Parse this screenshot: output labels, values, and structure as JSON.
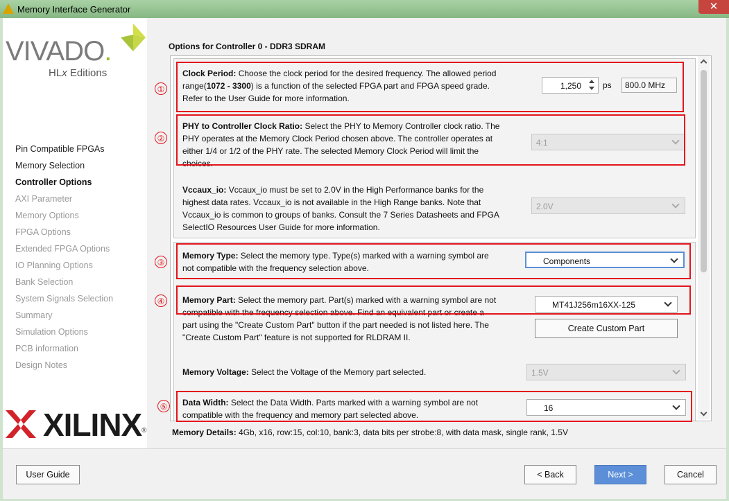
{
  "window": {
    "title": "Memory Interface Generator",
    "close_glyph": "✕"
  },
  "logo": {
    "vivado": "VIVADO",
    "vivado_dot": ".",
    "hlx_prefix": "HL",
    "hlx_x": "x",
    "hlx_suffix": " Editions",
    "xilinx": "XILINX",
    "reg": "®"
  },
  "sidebar": {
    "items": [
      {
        "label": "Pin Compatible FPGAs",
        "state": "done"
      },
      {
        "label": "Memory Selection",
        "state": "done"
      },
      {
        "label": "Controller Options",
        "state": "current"
      },
      {
        "label": "AXI Parameter",
        "state": "pending"
      },
      {
        "label": "Memory Options",
        "state": "pending"
      },
      {
        "label": "FPGA Options",
        "state": "pending"
      },
      {
        "label": "Extended FPGA Options",
        "state": "pending"
      },
      {
        "label": "IO Planning Options",
        "state": "pending"
      },
      {
        "label": "Bank Selection",
        "state": "pending"
      },
      {
        "label": "System Signals Selection",
        "state": "pending"
      },
      {
        "label": "Summary",
        "state": "pending"
      },
      {
        "label": "Simulation Options",
        "state": "pending"
      },
      {
        "label": "PCB information",
        "state": "pending"
      },
      {
        "label": "Design Notes",
        "state": "pending"
      }
    ]
  },
  "main": {
    "section_title": "Options for Controller 0 - DDR3 SDRAM",
    "clock_period": {
      "label": "Clock Period:",
      "desc_a": " Choose the clock period for the desired frequency. The allowed period",
      "desc_b_pre": "range(",
      "desc_b_range": "1072 - 3300",
      "desc_b_post": ") is a function of the selected FPGA part and FPGA speed grade.",
      "desc_c": "Refer to the User Guide for more information.",
      "value": "1,250",
      "unit": "ps",
      "freq": "800.0 MHz"
    },
    "phy_ratio": {
      "label": "PHY to Controller Clock Ratio:",
      "desc_a": " Select the PHY to Memory Controller clock ratio. The",
      "desc_b": "PHY operates at the Memory Clock Period chosen above. The controller operates at",
      "desc_c": "either 1/4 or 1/2 of the PHY rate. The selected Memory Clock Period will limit the",
      "desc_d": "choices.",
      "value": "4:1"
    },
    "vccaux": {
      "label": "Vccaux_io:",
      "desc_a": " Vccaux_io must be set to 2.0V in the High Performance banks for the",
      "desc_b": "highest data rates. Vccaux_io is not available in the High Range banks. Note that",
      "desc_c": "Vccaux_io is common to groups of banks. Consult the 7 Series Datasheets and FPGA",
      "desc_d": "SelectIO Resources User Guide for more information.",
      "value": "2.0V"
    },
    "memory_type": {
      "label": "Memory Type:",
      "desc_a": " Select the memory type. Type(s) marked with a warning symbol are",
      "desc_b": "not compatible with the frequency selection above.",
      "value": "Components"
    },
    "memory_part": {
      "label": "Memory Part:",
      "desc_a": " Select the memory part. Part(s) marked with a warning symbol are not",
      "desc_b": "compatible with the frequency selection above. Find an equivalent part or create a",
      "desc_c": "part using the \"Create Custom Part\" button if the part needed is not listed here. The",
      "desc_d": "\"Create Custom Part\" feature is not supported for RLDRAM II.",
      "value": "MT41J256m16XX-125",
      "custom_button": "Create Custom Part"
    },
    "memory_voltage": {
      "label": "Memory Voltage:",
      "desc_a": " Select the Voltage of the Memory part selected.",
      "value": "1.5V"
    },
    "data_width": {
      "label": "Data Width:",
      "desc_a": " Select the Data Width. Parts marked with a warning symbol are not",
      "desc_b": "compatible with the frequency and memory part selected above.",
      "value": "16"
    },
    "details": {
      "label": "Memory Details:",
      "text": " 4Gb, x16, row:15, col:10, bank:3, data bits per strobe:8, with data mask, single rank, 1.5V"
    }
  },
  "annotations": [
    "①",
    "②",
    "③",
    "④",
    "⑤"
  ],
  "footer": {
    "user_guide": "User Guide",
    "back": "< Back",
    "next": "Next >",
    "cancel": "Cancel"
  },
  "colors": {
    "annotation": "#e3141c",
    "primary_button": "#5d8fd8",
    "titlebar": "#a9d1a5"
  }
}
